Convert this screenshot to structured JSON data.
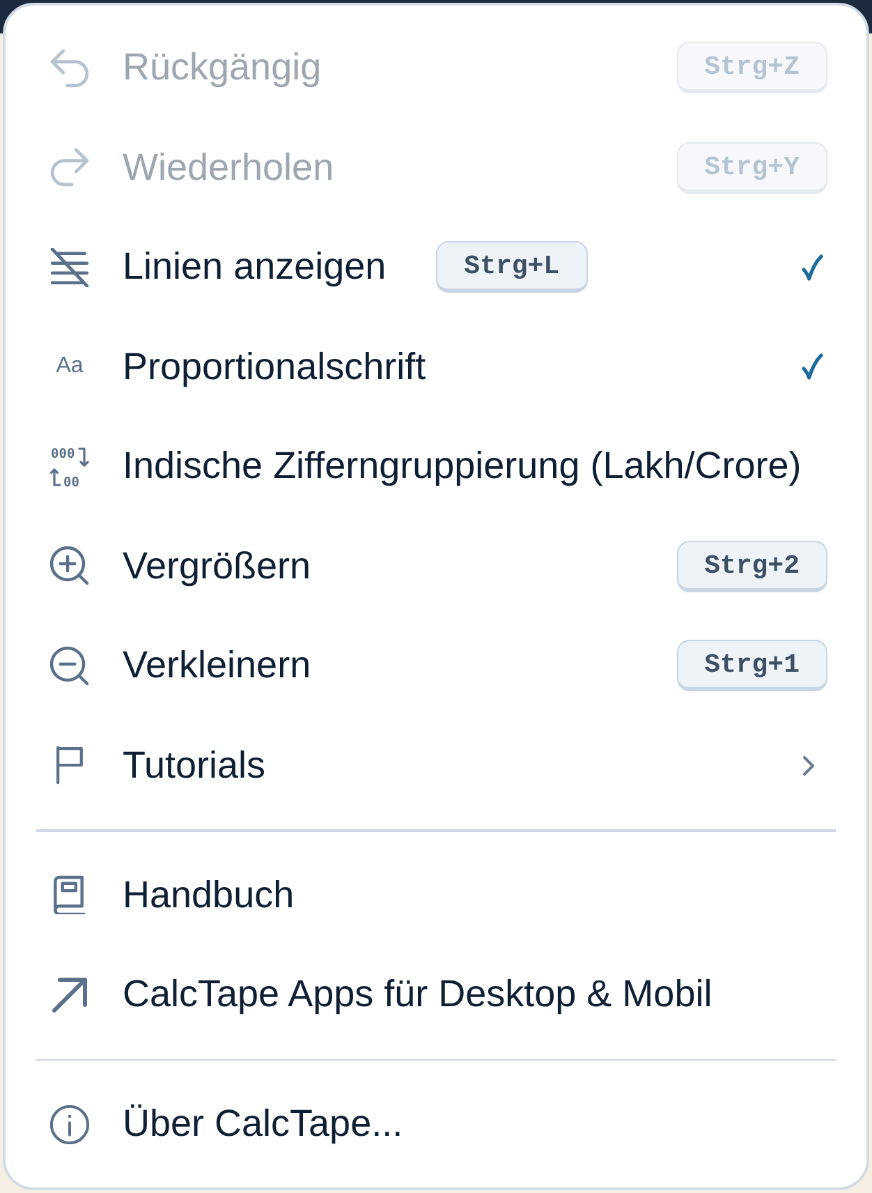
{
  "menu": {
    "sections": [
      {
        "items": [
          {
            "kind": "command",
            "label": "Rückgängig",
            "shortcut": "Strg+Z",
            "disabled": true
          },
          {
            "kind": "command",
            "label": "Wiederholen",
            "shortcut": "Strg+Y",
            "disabled": true
          },
          {
            "kind": "toggle",
            "label": "Linien anzeigen",
            "shortcut": "Strg+L",
            "disabled": false,
            "checked": true
          },
          {
            "kind": "toggle",
            "label": "Proportionalschrift",
            "icon_glyph": "Aa",
            "disabled": false,
            "checked": true
          },
          {
            "kind": "toggle",
            "label": "Indische Zifferngruppierung (Lakh/Crore)",
            "icon_digits": [
              "000",
              "00"
            ],
            "disabled": false,
            "checked": false
          },
          {
            "kind": "command",
            "label": "Vergrößern",
            "shortcut": "Strg+2",
            "disabled": false
          },
          {
            "kind": "command",
            "label": "Verkleinern",
            "shortcut": "Strg+1",
            "disabled": false
          },
          {
            "kind": "submenu",
            "label": "Tutorials",
            "disabled": false
          }
        ]
      },
      {
        "items": [
          {
            "kind": "command",
            "label": "Handbuch",
            "disabled": false
          },
          {
            "kind": "command",
            "label": "CalcTape Apps für Desktop & Mobil",
            "disabled": false
          }
        ]
      },
      {
        "items": [
          {
            "kind": "command",
            "label": "Über CalcTape...",
            "disabled": false
          }
        ]
      }
    ]
  }
}
